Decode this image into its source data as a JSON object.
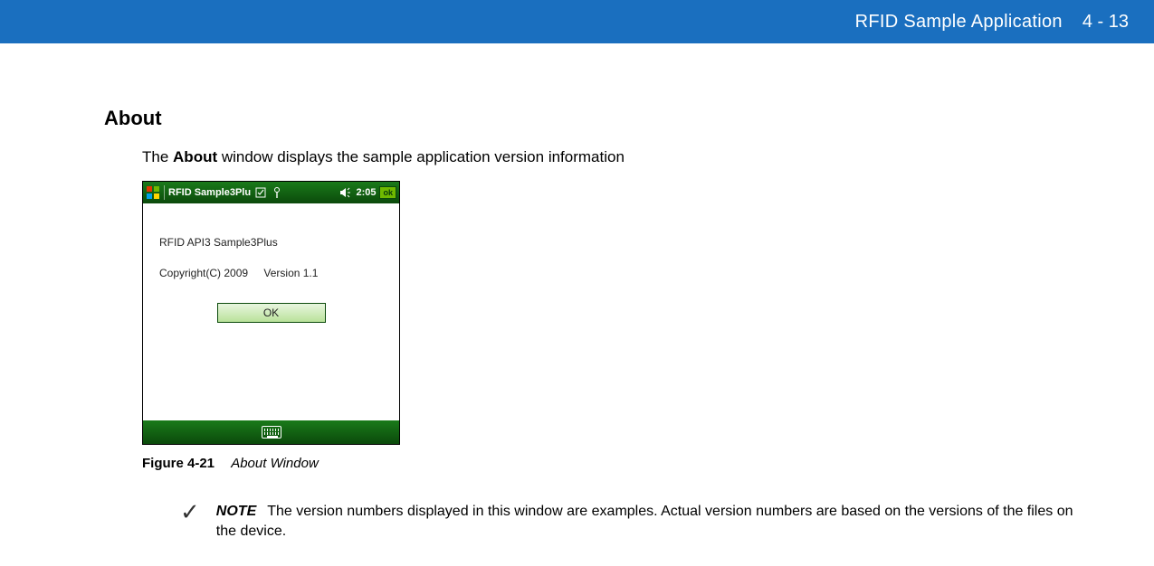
{
  "header": {
    "title": "RFID Sample Application",
    "page_num": "4 - 13"
  },
  "section": {
    "heading": "About",
    "intro_prefix": "The ",
    "intro_bold": "About",
    "intro_suffix": " window displays the sample application version information"
  },
  "device": {
    "titlebar": {
      "app_title": "RFID Sample3Plu",
      "time": "2:05",
      "ok": "ok"
    },
    "body": {
      "line1": "RFID API3 Sample3Plus",
      "copyright": "Copyright(C) 2009",
      "version": "Version 1.1",
      "ok_button": "OK"
    }
  },
  "figure": {
    "number": "Figure 4-21",
    "title": "About Window"
  },
  "note": {
    "label": "NOTE",
    "text": "The version numbers displayed in this window are examples. Actual version numbers are based on the versions of the files on the device."
  }
}
